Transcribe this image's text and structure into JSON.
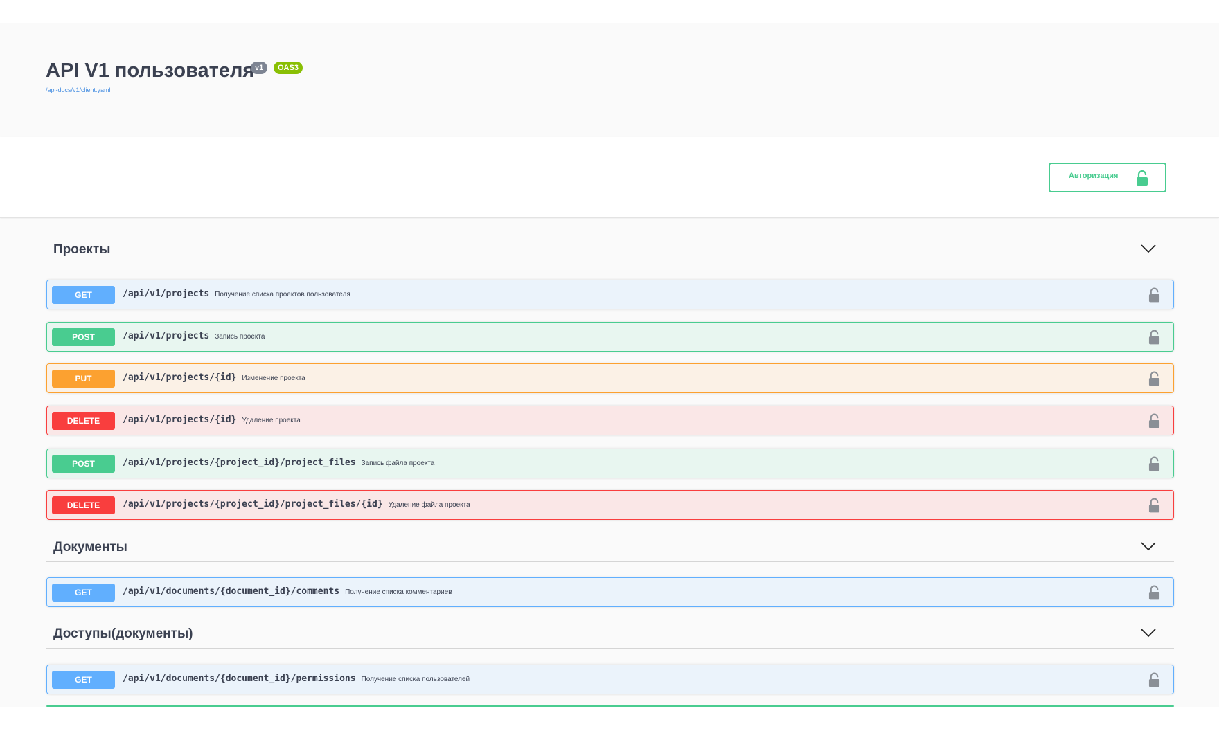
{
  "info": {
    "title": "API V1 пользователя",
    "version_badge": "v1",
    "oas_badge": "OAS3",
    "spec_link": "/api-docs/v1/client.yaml"
  },
  "auth_button": {
    "label": "Авторизация",
    "icon": "unlocked-icon"
  },
  "colors": {
    "get": "#61affe",
    "post": "#49cc90",
    "put": "#fca130",
    "delete": "#f93e3e",
    "auth": "#49cc90"
  },
  "tags": [
    {
      "name": "Проекты",
      "operations": [
        {
          "method": "GET",
          "path": "/api/v1/projects",
          "summary": "Получение списка проектов пользователя"
        },
        {
          "method": "POST",
          "path": "/api/v1/projects",
          "summary": "Запись проекта"
        },
        {
          "method": "PUT",
          "path": "/api/v1/projects/{id}",
          "summary": "Изменение проекта"
        },
        {
          "method": "DELETE",
          "path": "/api/v1/projects/{id}",
          "summary": "Удаление проекта"
        },
        {
          "method": "POST",
          "path": "/api/v1/projects/{project_id}/project_files",
          "summary": "Запись файла проекта"
        },
        {
          "method": "DELETE",
          "path": "/api/v1/projects/{project_id}/project_files/{id}",
          "summary": "Удаление файла проекта"
        }
      ]
    },
    {
      "name": "Документы",
      "operations": [
        {
          "method": "GET",
          "path": "/api/v1/documents/{document_id}/comments",
          "summary": "Получение списка комментариев"
        }
      ]
    },
    {
      "name": "Доступы(документы)",
      "operations": [
        {
          "method": "GET",
          "path": "/api/v1/documents/{document_id}/permissions",
          "summary": "Получение списка пользователей"
        }
      ]
    }
  ]
}
